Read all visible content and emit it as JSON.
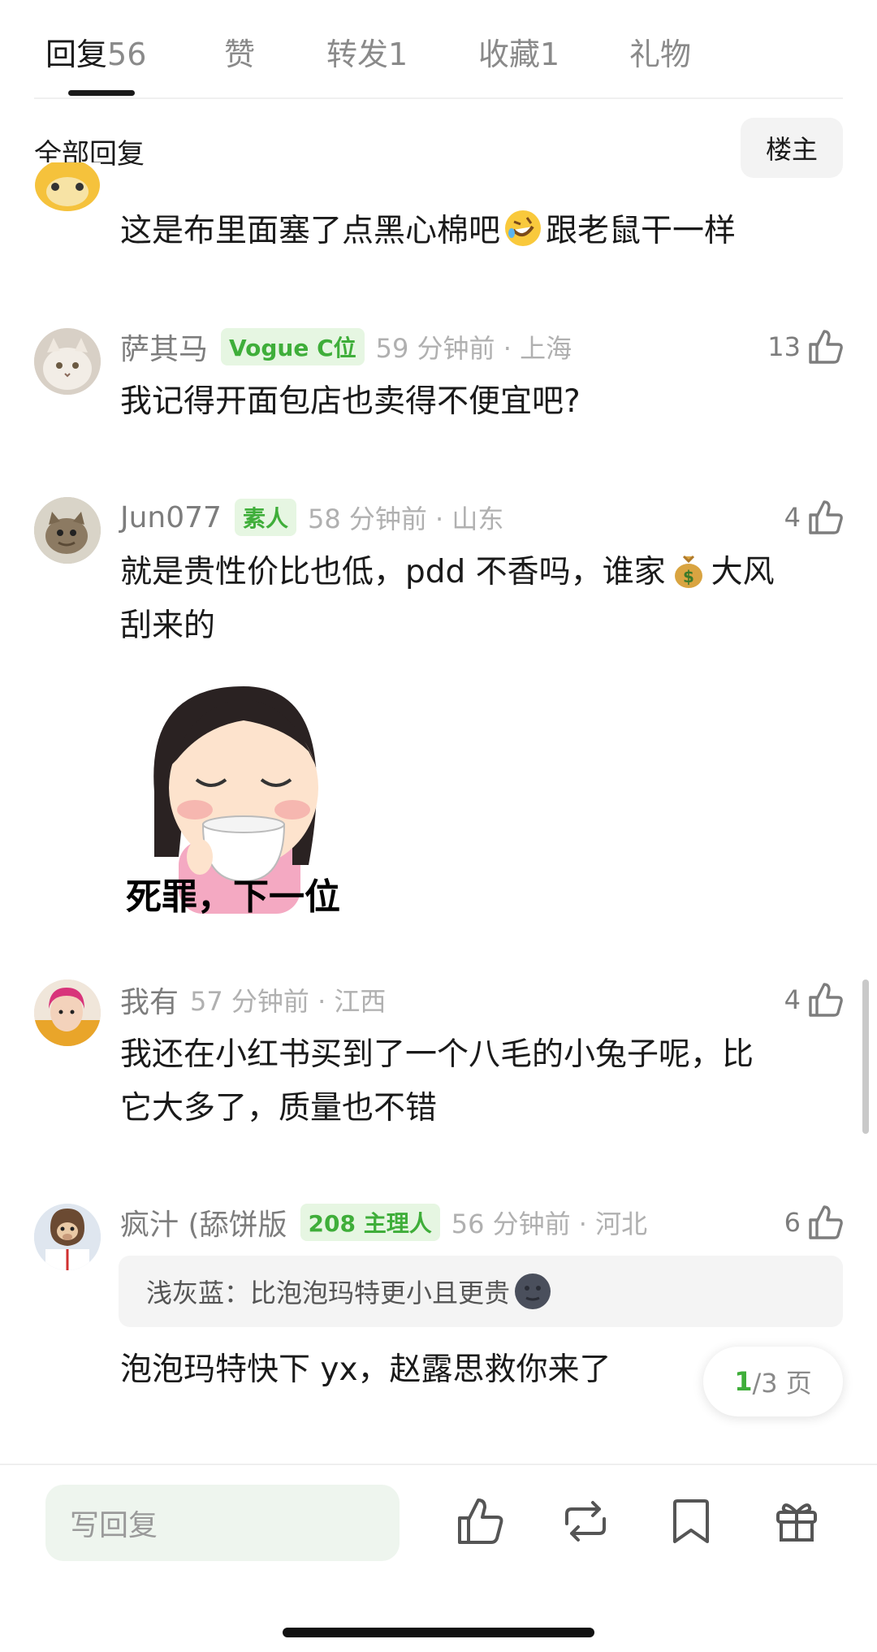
{
  "tabs": [
    {
      "label": "回复",
      "count": "56"
    },
    {
      "label": "赞",
      "count": ""
    },
    {
      "label": "转发1",
      "count": ""
    },
    {
      "label": "收藏1",
      "count": ""
    },
    {
      "label": "礼物",
      "count": ""
    }
  ],
  "filter": {
    "title": "全部回复",
    "owner_label": "楼主"
  },
  "comments": [
    {
      "text_before": "这是布里面塞了点黑心棉吧",
      "text_after": "跟老鼠干一样",
      "emoji": "rofl-emoji"
    },
    {
      "name": "萨其马",
      "badge": "Vogue C位",
      "time": "59 分钟前 · 上海",
      "likes": "13",
      "text": "我记得开面包店也卖得不便宜吧?"
    },
    {
      "name": "Jun077",
      "badge": "素人",
      "time": "58 分钟前 · 山东",
      "likes": "4",
      "text_line1_before": "就是贵性价比也低，pdd 不香吗，谁家",
      "text_line1_after": "大风",
      "text_line2": "刮来的",
      "emoji": "money-bag-emoji",
      "sticker_caption": "死罪，下一位"
    },
    {
      "name": "我有",
      "time": "57 分钟前 · 江西",
      "likes": "4",
      "text_line1": "我还在小红书买到了一个八毛的小兔子呢，比",
      "text_line2": "它大多了，质量也不错"
    },
    {
      "name": "疯汁 (舔饼版",
      "badge": "208 主理人",
      "time": "56 分钟前 · 河北",
      "likes": "6",
      "quote_author": "浅灰蓝：",
      "quote_text": "比泡泡玛特更小且更贵",
      "quote_emoji": "new-moon-face-emoji",
      "text": "泡泡玛特快下 yx，赵露思救你来了"
    }
  ],
  "pager": {
    "current": "1",
    "total": "/3 页"
  },
  "bottom_bar": {
    "reply_placeholder": "写回复"
  },
  "colors": {
    "accent_green": "#3fae3a",
    "badge_bg": "#e6f6e2"
  }
}
